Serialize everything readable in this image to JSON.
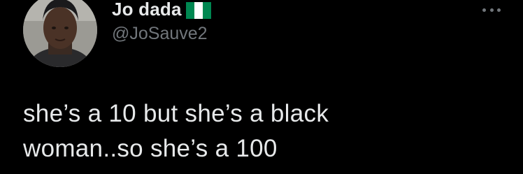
{
  "tweet": {
    "author": {
      "display_name": "Jo dada",
      "flag_icon": "nigeria-flag-icon",
      "handle": "@JoSauve2"
    },
    "more_icon": "more-options-icon",
    "text_lines": [
      "she’s a 10 but she’s a black",
      "woman..so she’s a 100"
    ]
  },
  "colors": {
    "background": "#000000",
    "text_primary": "#e7e9ea",
    "text_secondary": "#71767b",
    "flag_green": "#008751",
    "flag_white": "#ffffff"
  }
}
